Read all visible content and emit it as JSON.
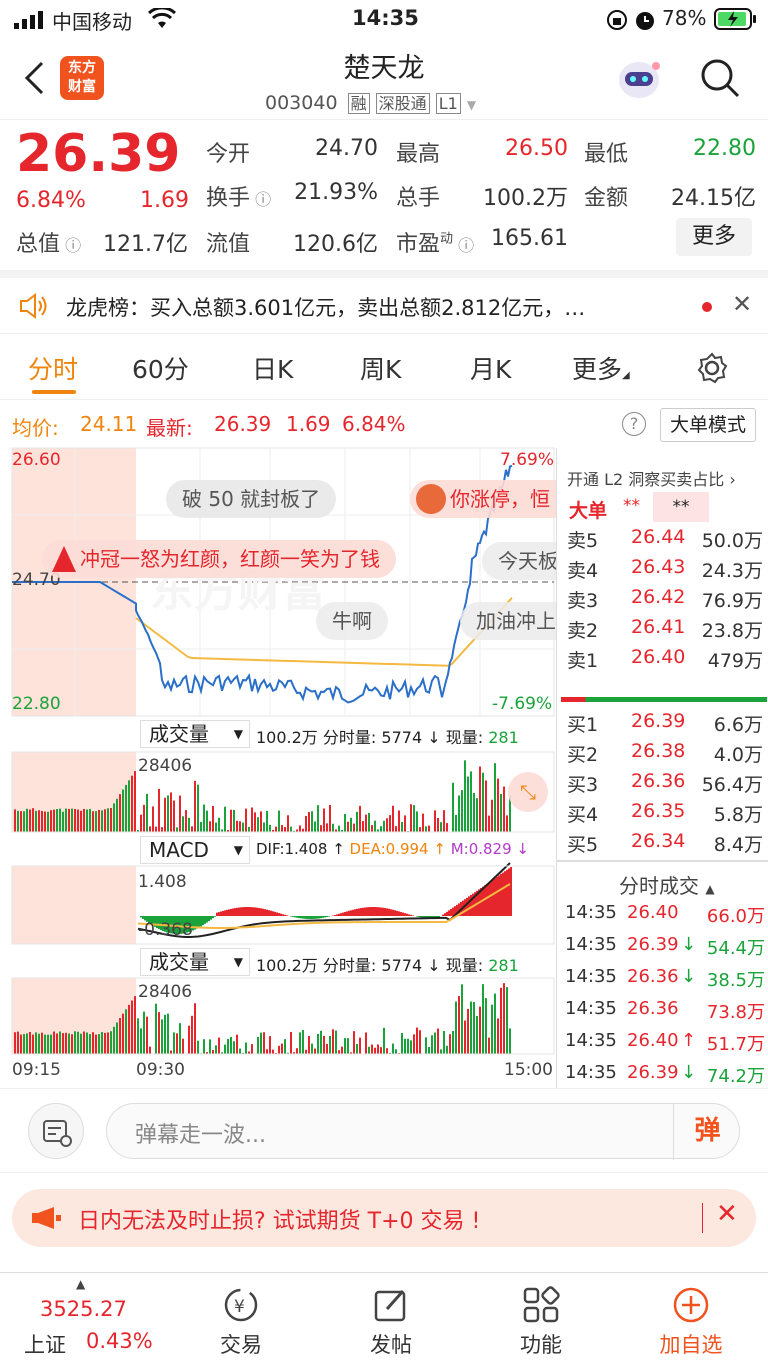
{
  "status": {
    "carrier": "中国移动",
    "time": "14:35",
    "battery": "78%"
  },
  "header": {
    "logo_line1": "东方",
    "logo_line2": "财富",
    "stock_name": "楚天龙",
    "stock_code": "003040",
    "tags": [
      "融",
      "深股通",
      "L1"
    ]
  },
  "quote": {
    "price": "26.39",
    "change_pct": "6.84%",
    "change": "1.69",
    "fields": {
      "open_label": "今开",
      "open": "24.70",
      "high_label": "最高",
      "high": "26.50",
      "low_label": "最低",
      "low": "22.80",
      "turnover_label": "换手",
      "turnover": "21.93%",
      "volume_label": "总手",
      "volume": "100.2万",
      "amount_label": "金额",
      "amount": "24.15亿",
      "total_cap_label": "总值",
      "total_cap": "121.7亿",
      "float_cap_label": "流值",
      "float_cap": "120.6亿",
      "pe_label": "市盈",
      "pe_sup": "动",
      "pe": "165.61"
    },
    "more_button": "更多"
  },
  "notice": {
    "text": "龙虎榜：买入总额3.601亿元，卖出总额2.812亿元，…"
  },
  "tabs": [
    "分时",
    "60分",
    "日K",
    "周K",
    "月K",
    "更多"
  ],
  "info_row": {
    "avg_label": "均价:",
    "avg": "24.11",
    "latest_label": "最新:",
    "latest": "26.39",
    "latest_change": "1.69",
    "latest_pct": "6.84%",
    "big_order_button": "大单模式"
  },
  "main_chart": {
    "y_top": "26.60",
    "y_mid": "24.70",
    "y_bottom": "22.80",
    "pct_top": "7.69%",
    "pct_bottom": "-7.69%",
    "bullets": [
      "破 50 就封板了",
      "你涨停，恒",
      "冲冠一怒为红颜，红颜一笑为了钱",
      "今天板",
      "牛啊",
      "加油冲上"
    ],
    "watermark": "东方财富"
  },
  "volume_bar1": {
    "label": "成交量",
    "total": "100.2万",
    "period_label": "分时量:",
    "period_value": "5774",
    "now_label": "现量:",
    "now_value": "281",
    "max": "28406"
  },
  "macd_bar": {
    "label": "MACD",
    "dif": "DIF:1.408",
    "dea": "DEA:0.994",
    "m": "M:0.829",
    "top_value": "1.408",
    "bottom_value": "-0.368"
  },
  "volume_bar2": {
    "label": "成交量",
    "total": "100.2万",
    "period_label": "分时量:",
    "period_value": "5774",
    "now_label": "现量:",
    "now_value": "281",
    "max": "28406"
  },
  "time_axis": [
    "09:15",
    "09:30",
    "15:00"
  ],
  "right_panel": {
    "l2_header": "开通 L2 洞察买卖占比",
    "big_order_label": "大单",
    "big_order_stars1": "**",
    "big_order_stars2": "**",
    "asks": [
      {
        "label": "卖5",
        "price": "26.44",
        "vol": "50.0万"
      },
      {
        "label": "卖4",
        "price": "26.43",
        "vol": "24.3万"
      },
      {
        "label": "卖3",
        "price": "26.42",
        "vol": "76.9万"
      },
      {
        "label": "卖2",
        "price": "26.41",
        "vol": "23.8万"
      },
      {
        "label": "卖1",
        "price": "26.40",
        "vol": "479万"
      }
    ],
    "bids": [
      {
        "label": "买1",
        "price": "26.39",
        "vol": "6.6万"
      },
      {
        "label": "买2",
        "price": "26.38",
        "vol": "4.0万"
      },
      {
        "label": "买3",
        "price": "26.36",
        "vol": "56.4万"
      },
      {
        "label": "买4",
        "price": "26.35",
        "vol": "5.8万"
      },
      {
        "label": "买5",
        "price": "26.34",
        "vol": "8.4万"
      }
    ],
    "ticks_header": "分时成交",
    "ticks": [
      {
        "time": "14:35",
        "price": "26.40",
        "arrow": "",
        "vol": "66.0万",
        "color": "red"
      },
      {
        "time": "14:35",
        "price": "26.39",
        "arrow": "↓",
        "vol": "54.4万",
        "color": "green"
      },
      {
        "time": "14:35",
        "price": "26.36",
        "arrow": "↓",
        "vol": "38.5万",
        "color": "green"
      },
      {
        "time": "14:35",
        "price": "26.36",
        "arrow": "",
        "vol": "73.8万",
        "color": "red"
      },
      {
        "time": "14:35",
        "price": "26.40",
        "arrow": "↑",
        "vol": "51.7万",
        "color": "red"
      },
      {
        "time": "14:35",
        "price": "26.39",
        "arrow": "↓",
        "vol": "74.2万",
        "color": "green"
      }
    ]
  },
  "danmu": {
    "placeholder": "弹幕走一波...",
    "button": "弹"
  },
  "ad": {
    "text": "日内无法及时止损? 试试期货 T+0 交易 !"
  },
  "bottom_nav": {
    "index_value": "3525.27",
    "index_name": "上证",
    "index_pct": "0.43%",
    "items": [
      "交易",
      "发帖",
      "功能",
      "加自选"
    ]
  },
  "colors": {
    "up": "#e5262c",
    "down": "#1aa33a",
    "brand": "#f0850d",
    "price_line": "#2a6fc9",
    "avg_line": "#f5b942"
  }
}
